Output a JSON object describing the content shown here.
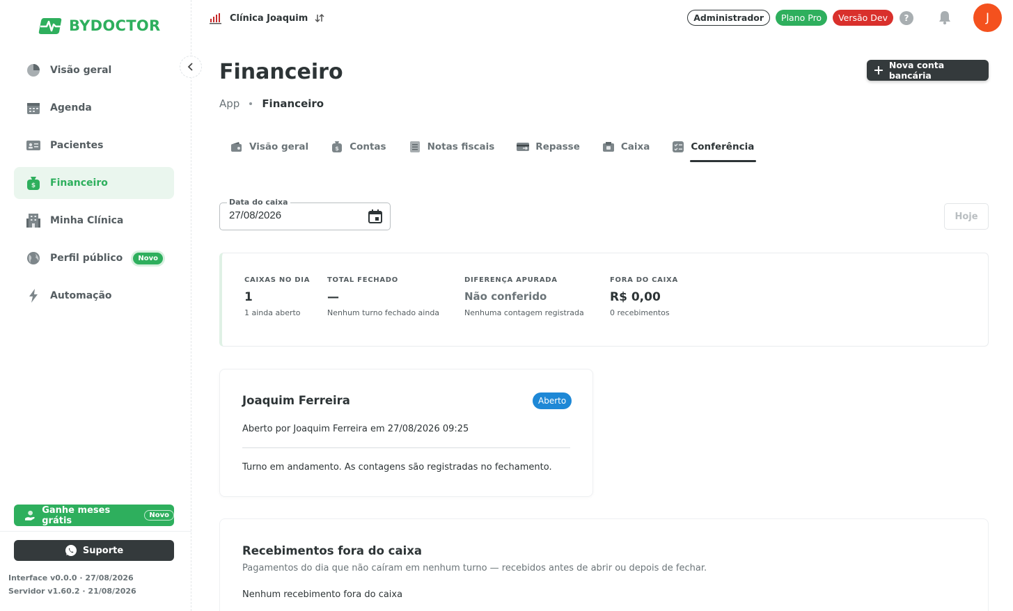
{
  "app": {
    "brand": "BYDOCTOR"
  },
  "sidebar": {
    "items": [
      {
        "label": "Visão geral"
      },
      {
        "label": "Agenda"
      },
      {
        "label": "Pacientes"
      },
      {
        "label": "Financeiro",
        "active": true
      },
      {
        "label": "Minha Clínica"
      },
      {
        "label": "Perfil público",
        "badge": "Novo"
      },
      {
        "label": "Automação"
      }
    ],
    "promo": {
      "label": "Ganhe meses grátis",
      "badge": "Novo"
    },
    "support": {
      "label": "Suporte"
    },
    "versions": {
      "interface": "Interface v0.0.0 · 27/08/2026",
      "server": "Servidor v1.60.2 · 21/08/2026"
    }
  },
  "topbar": {
    "clinic": "Clínica Joaquim",
    "badges": {
      "admin": "Administrador",
      "plan": "Plano Pro",
      "version": "Versão Dev"
    },
    "help": "?",
    "avatar_initial": "J"
  },
  "page": {
    "title": "Financeiro",
    "breadcrumb": {
      "root": "App",
      "current": "Financeiro"
    },
    "new_account_button": "Nova conta bancária"
  },
  "tabs": [
    {
      "label": "Visão geral"
    },
    {
      "label": "Contas"
    },
    {
      "label": "Notas fiscais"
    },
    {
      "label": "Repasse"
    },
    {
      "label": "Caixa"
    },
    {
      "label": "Conferência",
      "active": true
    }
  ],
  "filters": {
    "date_label": "Data do caixa",
    "date_value": "27/08/2026",
    "today_button": "Hoje"
  },
  "summary": {
    "caixas": {
      "label": "CAIXAS NO DIA",
      "value": "1",
      "sub": "1 ainda aberto"
    },
    "fechado": {
      "label": "TOTAL FECHADO",
      "value": "—",
      "sub": "Nenhum turno fechado ainda"
    },
    "diferenca": {
      "label": "DIFERENÇA APURADA",
      "value": "Não conferido",
      "sub": "Nenhuma contagem registrada"
    },
    "fora": {
      "label": "FORA DO CAIXA",
      "value": "R$ 0,00",
      "sub": "0 recebimentos"
    }
  },
  "register_card": {
    "name": "Joaquim Ferreira",
    "status": "Aberto",
    "opened_by": "Aberto por Joaquim Ferreira em 27/08/2026 09:25",
    "note": "Turno em andamento. As contagens são registradas no fechamento."
  },
  "outside_section": {
    "title": "Recebimentos fora do caixa",
    "description": "Pagamentos do dia que não caíram em nenhum turno — recebidos antes de abrir ou depois de fechar.",
    "empty": "Nenhum recebimento fora do caixa"
  },
  "colors": {
    "brand_green": "#2eaf5d",
    "dark": "#343a3c",
    "danger": "#d9302c",
    "info": "#1e88d6",
    "avatar": "#f4511e"
  }
}
